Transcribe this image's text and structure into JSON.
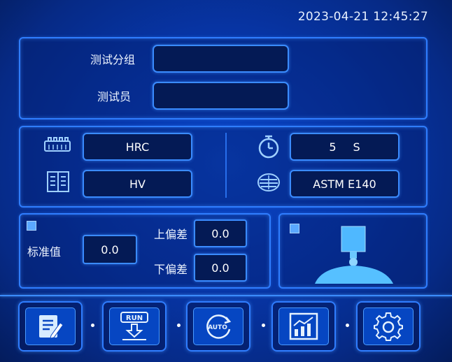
{
  "datetime": "2023-04-21 12:45:27",
  "test_info": {
    "group_label": "测试分组",
    "group_value": "",
    "tester_label": "测试员",
    "tester_value": ""
  },
  "settings": {
    "scale": "HRC",
    "conversion": "HV",
    "dwell_value": "5",
    "dwell_unit": "S",
    "standard": "ASTM E140"
  },
  "tolerance": {
    "standard_label": "标准值",
    "standard_value": "0.0",
    "upper_label": "上偏差",
    "upper_value": "0.0",
    "lower_label": "下偏差",
    "lower_value": "0.0"
  },
  "nav": {
    "run_label": "RUN",
    "auto_label": "AUTO"
  },
  "colors": {
    "accent": "#2f7dff",
    "background": "#0735a6",
    "field": "#041a55"
  },
  "icons": [
    "hardness-scale-icon",
    "conversion-table-icon",
    "timer-icon",
    "standard-book-icon",
    "edit-icon",
    "run-icon",
    "auto-icon",
    "chart-icon",
    "gear-icon"
  ]
}
